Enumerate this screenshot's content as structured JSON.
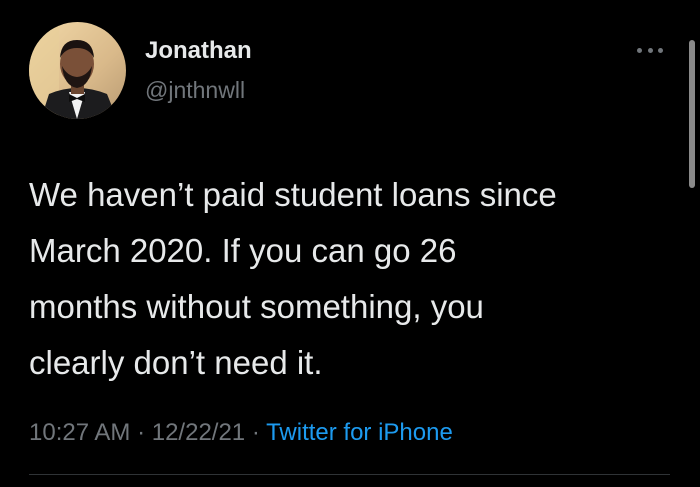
{
  "author": {
    "display_name": "Jonathan",
    "handle": "@jnthnwll"
  },
  "tweet": {
    "lines": [
      "We haven’t paid student loans since",
      "March 2020. If you can go 26",
      "months without something, you",
      "clearly don’t need it."
    ]
  },
  "meta": {
    "time": "10:27 AM",
    "separator_1": " · ",
    "date": "12/22/21",
    "separator_2": " · ",
    "source": "Twitter for iPhone"
  },
  "icons": {
    "more": "more-options-icon",
    "avatar": "profile-photo"
  },
  "colors": {
    "background": "#000000",
    "primary_text": "#e7e9ea",
    "secondary_text": "#71767b",
    "link": "#1d9bf0"
  }
}
